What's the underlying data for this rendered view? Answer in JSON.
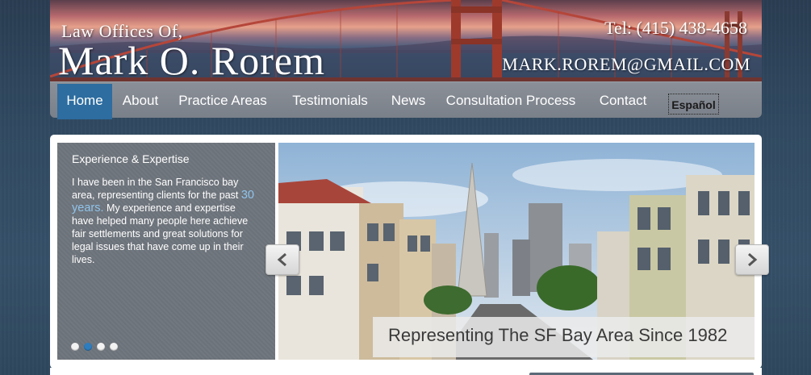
{
  "header": {
    "firm_line1": "Law Offices Of,",
    "firm_line2": "Mark O. Rorem",
    "phone": "Tel: (415) 438-4658",
    "email": "MARK.ROREM@GMAIL.COM"
  },
  "nav": {
    "items": [
      {
        "label": "Home",
        "active": true
      },
      {
        "label": "About",
        "active": false
      },
      {
        "label": "Practice Areas",
        "active": false
      },
      {
        "label": "Testimonials",
        "active": false
      },
      {
        "label": "News",
        "active": false
      },
      {
        "label": "Consultation Process",
        "active": false
      },
      {
        "label": "Contact",
        "active": false
      }
    ],
    "language_button": "Español"
  },
  "slider": {
    "title": "Experience & Expertise",
    "body_before": "I have been in the San Francisco bay area, representing clients for the past",
    "body_highlight": "30 years.",
    "body_after": "My experience and expertise have helped many people here achieve fair settlements and great solutions for legal issues that have come up in their lives.",
    "caption": "Representing The SF Bay Area Since 1982",
    "dots_count": 4,
    "active_dot": 1,
    "prev_icon": "chevron-left-icon",
    "next_icon": "chevron-right-icon"
  },
  "colors": {
    "accent": "#2d6da0",
    "nav_bg": "#7f858e",
    "page_bg": "#314a62",
    "highlight_text": "#8fc4ec"
  }
}
